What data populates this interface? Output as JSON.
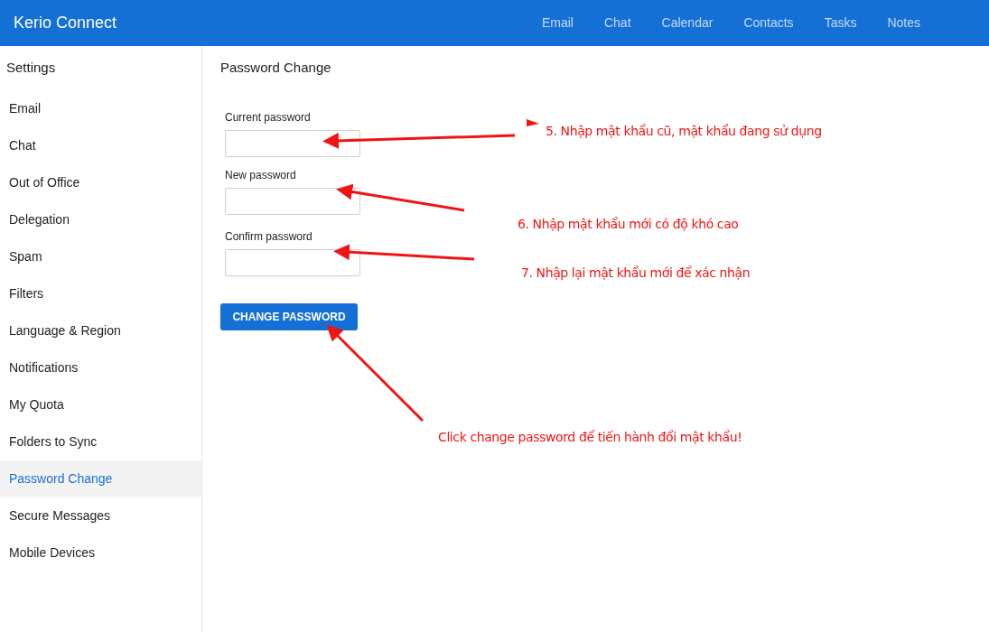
{
  "app": {
    "title": "Kerio Connect"
  },
  "nav": [
    {
      "label": "Email"
    },
    {
      "label": "Chat"
    },
    {
      "label": "Calendar"
    },
    {
      "label": "Contacts"
    },
    {
      "label": "Tasks"
    },
    {
      "label": "Notes"
    }
  ],
  "sidebar": {
    "title": "Settings",
    "items": [
      {
        "label": "Email",
        "selected": false
      },
      {
        "label": "Chat",
        "selected": false
      },
      {
        "label": "Out of Office",
        "selected": false
      },
      {
        "label": "Delegation",
        "selected": false
      },
      {
        "label": "Spam",
        "selected": false
      },
      {
        "label": "Filters",
        "selected": false
      },
      {
        "label": "Language & Region",
        "selected": false
      },
      {
        "label": "Notifications",
        "selected": false
      },
      {
        "label": "My Quota",
        "selected": false
      },
      {
        "label": "Folders to Sync",
        "selected": false
      },
      {
        "label": "Password Change",
        "selected": true
      },
      {
        "label": "Secure Messages",
        "selected": false
      },
      {
        "label": "Mobile Devices",
        "selected": false
      }
    ]
  },
  "content": {
    "title": "Password Change",
    "fields": [
      {
        "label": "Current password"
      },
      {
        "label": "New password"
      },
      {
        "label": "Confirm password"
      }
    ],
    "button": "CHANGE PASSWORD"
  },
  "annotations": [
    {
      "text": "5. Nhập mật khẩu cũ, mật khẩu đang sử dụng"
    },
    {
      "text": "6. Nhập mật khẩu mới có độ khó cao"
    },
    {
      "text": "7. Nhập lại mật khẩu mới để xác nhận"
    },
    {
      "text": "Click change password để tiến hành đổi mật khẩu!"
    }
  ]
}
